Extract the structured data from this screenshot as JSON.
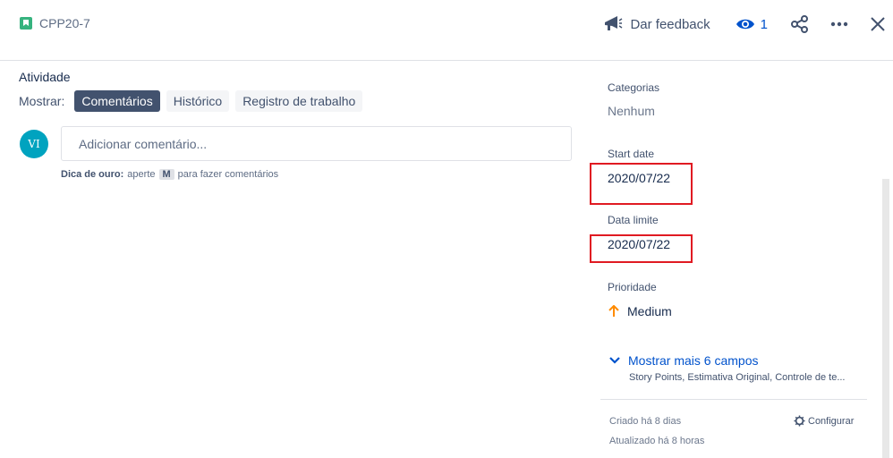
{
  "header": {
    "issue_key": "CPP20-7",
    "feedback_label": "Dar feedback",
    "watch_count": "1"
  },
  "activity": {
    "title": "Atividade",
    "show_label": "Mostrar:",
    "tabs": [
      {
        "label": "Comentários",
        "active": true
      },
      {
        "label": "Histórico",
        "active": false
      },
      {
        "label": "Registro de trabalho",
        "active": false
      }
    ],
    "avatar_initials": "VI",
    "comment_placeholder": "Adicionar comentário...",
    "tip_bold": "Dica de ouro:",
    "tip_pre": "aperte",
    "tip_key": "M",
    "tip_post": "para fazer comentários"
  },
  "sidebar": {
    "categories_label": "Categorias",
    "categories_value": "Nenhum",
    "start_date_label": "Start date",
    "start_date_value": "2020/07/22",
    "due_date_label": "Data limite",
    "due_date_value": "2020/07/22",
    "priority_label": "Prioridade",
    "priority_value": "Medium",
    "more_fields_label": "Mostrar mais 6 campos",
    "more_fields_sub": "Story Points, Estimativa Original, Controle de te...",
    "created": "Criado há 8 dias",
    "updated": "Atualizado há 8 horas",
    "configure_label": "Configurar"
  },
  "colors": {
    "accent": "#0052cc",
    "priority_medium": "#ff8b00",
    "highlight_box": "#e01a22",
    "story_icon": "#36b37e"
  }
}
